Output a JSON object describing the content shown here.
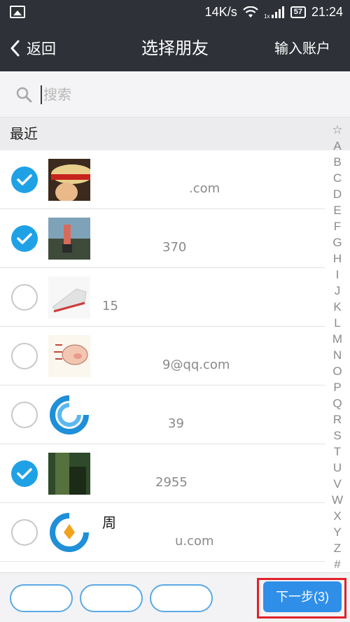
{
  "status_bar": {
    "network_speed": "14K/s",
    "battery": "57",
    "time": "21:24"
  },
  "nav": {
    "back_label": "返回",
    "title": "选择朋友",
    "action_label": "输入账户"
  },
  "search": {
    "placeholder": "搜索"
  },
  "section": {
    "label": "最近"
  },
  "contacts": [
    {
      "checked": true,
      "name": "",
      "account": ".com"
    },
    {
      "checked": true,
      "name": "",
      "account": "370"
    },
    {
      "checked": false,
      "name": "",
      "account": "15"
    },
    {
      "checked": false,
      "name": "",
      "account": "9@qq.com"
    },
    {
      "checked": false,
      "name": "",
      "account": "39"
    },
    {
      "checked": true,
      "name": "",
      "account": "2955"
    },
    {
      "checked": false,
      "name": "周",
      "account": "u.com"
    }
  ],
  "index_letters": [
    "☆",
    "A",
    "B",
    "C",
    "D",
    "E",
    "F",
    "G",
    "H",
    "I",
    "J",
    "K",
    "L",
    "M",
    "N",
    "O",
    "P",
    "Q",
    "R",
    "S",
    "T",
    "U",
    "V",
    "W",
    "X",
    "Y",
    "Z",
    "#"
  ],
  "bottom_bar": {
    "next_label": "下一步(3)"
  },
  "colors": {
    "nav_bg": "#2e3138",
    "accent": "#1fa1e6",
    "highlight_border": "#e0222a"
  }
}
